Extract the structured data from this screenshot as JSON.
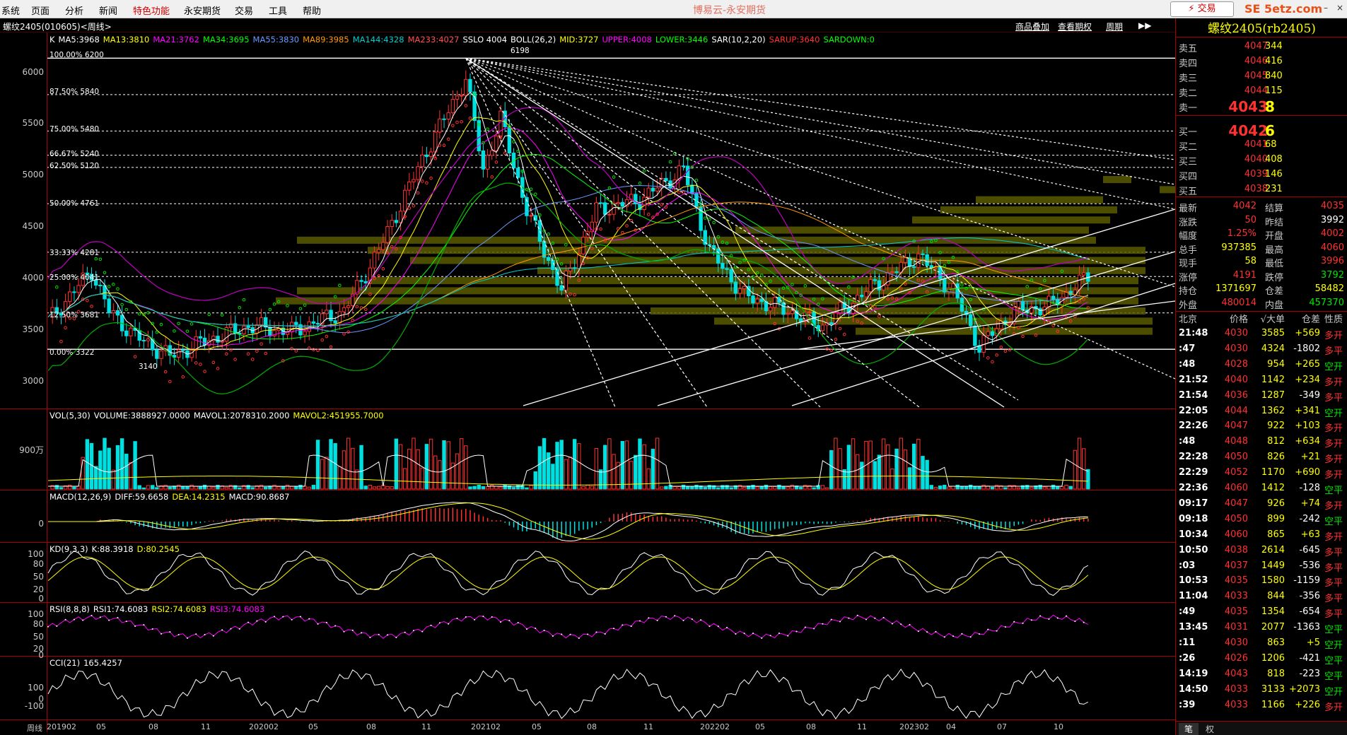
{
  "menu": {
    "items": [
      "系统",
      "页面",
      "分析",
      "新闻",
      "特色功能",
      "永安期货",
      "交易",
      "工具",
      "帮助"
    ],
    "app_title": "博易云-永安期货",
    "trade_button": "⚡ 交易",
    "site_mark": "SE 5etz.com"
  },
  "infobar": {
    "symbol": "螺纹2405(010605)<周线>",
    "links": [
      "商品叠加",
      "查看期权",
      "周期"
    ]
  },
  "main_chart": {
    "legend": [
      {
        "text": "K",
        "color": "#ffffff"
      },
      {
        "text": "MA5:3968",
        "color": "#ffffff"
      },
      {
        "text": "MA13:3810",
        "color": "#ffff00"
      },
      {
        "text": "MA21:3762",
        "color": "#ff00ff"
      },
      {
        "text": "MA34:3695",
        "color": "#00ff00"
      },
      {
        "text": "MA55:3830",
        "color": "#6699ff"
      },
      {
        "text": "MA89:3985",
        "color": "#ff9900"
      },
      {
        "text": "MA144:4328",
        "color": "#00cccc"
      },
      {
        "text": "MA233:4027",
        "color": "#ff5050"
      },
      {
        "text": "SSLO 4004",
        "color": "#ffffff"
      },
      {
        "text": "BOLL(26,2)",
        "color": "#ffffff"
      },
      {
        "text": "MID:3727",
        "color": "#ffff00"
      },
      {
        "text": "UPPER:4008",
        "color": "#ff00ff"
      },
      {
        "text": "LOWER:3446",
        "color": "#00ff00"
      },
      {
        "text": "SAR(10,2,20)",
        "color": "#ffffff"
      },
      {
        "text": "SARUP:3640",
        "color": "#ff3232"
      },
      {
        "text": "SARDOWN:0",
        "color": "#00ff00"
      }
    ],
    "y_labels": [
      "6000",
      "5500",
      "5000",
      "4500",
      "4000",
      "3500",
      "3000"
    ],
    "fib_labels": [
      "100.00% 6200",
      "87.50% 5840",
      "75.00% 5480",
      "66.67% 5240",
      "62.50% 5120",
      "50.00% 4761",
      "33.33% 4281",
      "25.00% 4041",
      "12.50% 3681",
      "0.00% 3322"
    ],
    "high_label": "6198",
    "low_label": "3140"
  },
  "vol_panel": {
    "legend": [
      {
        "text": "VOL(5,30)",
        "color": "#ffffff"
      },
      {
        "text": "VOLUME:3888927.0000",
        "color": "#ffffff"
      },
      {
        "text": "MAVOL1:2078310.2000",
        "color": "#ffffff"
      },
      {
        "text": "MAVOL2:451955.7000",
        "color": "#ffff00"
      }
    ],
    "y_labels": [
      "900万"
    ]
  },
  "macd_panel": {
    "legend": [
      {
        "text": "MACD(12,26,9)",
        "color": "#ffffff"
      },
      {
        "text": "DIFF:59.6658",
        "color": "#ffffff"
      },
      {
        "text": "DEA:14.2315",
        "color": "#ffff00"
      },
      {
        "text": "MACD:90.8687",
        "color": "#ffffff"
      }
    ],
    "y_labels": [
      "0"
    ]
  },
  "kd_panel": {
    "legend": [
      {
        "text": "KD(9,3,3)",
        "color": "#ffffff"
      },
      {
        "text": "K:88.3918",
        "color": "#ffffff"
      },
      {
        "text": "D:80.2545",
        "color": "#ffff00"
      }
    ],
    "y_labels": [
      "100",
      "80",
      "50",
      "20",
      "0"
    ]
  },
  "rsi_panel": {
    "legend": [
      {
        "text": "RSI(8,8,8)",
        "color": "#ffffff"
      },
      {
        "text": "RSI1:74.6083",
        "color": "#ffffff"
      },
      {
        "text": "RSI2:74.6083",
        "color": "#ffff00"
      },
      {
        "text": "RSI3:74.6083",
        "color": "#ff00ff"
      }
    ],
    "y_labels": [
      "100",
      "80",
      "50",
      "20",
      "0"
    ]
  },
  "cci_panel": {
    "legend": [
      {
        "text": "CCI(21)",
        "color": "#ffffff"
      },
      {
        "text": "165.4257",
        "color": "#ffffff"
      }
    ],
    "y_labels": [
      "100",
      "0",
      "-100"
    ]
  },
  "x_axis": {
    "title": "周线",
    "labels": [
      "201902",
      "05",
      "08",
      "11",
      "202002",
      "05",
      "08",
      "11",
      "202102",
      "05",
      "08",
      "11",
      "202202",
      "05",
      "08",
      "11",
      "202302",
      "04",
      "07",
      "10"
    ]
  },
  "quote": {
    "title": "螺纹2405(rb2405)",
    "asks": [
      {
        "label": "卖五",
        "price": "4047",
        "vol": "344"
      },
      {
        "label": "卖四",
        "price": "4046",
        "vol": "416"
      },
      {
        "label": "卖三",
        "price": "4045",
        "vol": "840"
      },
      {
        "label": "卖二",
        "price": "4044",
        "vol": "115"
      },
      {
        "label": "卖一",
        "price": "4043",
        "vol": "8"
      }
    ],
    "bids": [
      {
        "label": "买一",
        "price": "4042",
        "vol": "6"
      },
      {
        "label": "买二",
        "price": "4041",
        "vol": "68"
      },
      {
        "label": "买三",
        "price": "4040",
        "vol": "408"
      },
      {
        "label": "买四",
        "price": "4039",
        "vol": "146"
      },
      {
        "label": "买五",
        "price": "4038",
        "vol": "231"
      }
    ],
    "stats": [
      {
        "l1": "最新",
        "v1": "4042",
        "c1": "red",
        "l2": "结算",
        "v2": "4035",
        "c2": "red"
      },
      {
        "l1": "涨跌",
        "v1": "50",
        "c1": "red",
        "l2": "昨结",
        "v2": "3992",
        "c2": "white"
      },
      {
        "l1": "幅度",
        "v1": "1.25%",
        "c1": "red",
        "l2": "开盘",
        "v2": "4002",
        "c2": "red"
      },
      {
        "l1": "总手",
        "v1": "937385",
        "c1": "yellow",
        "l2": "最高",
        "v2": "4060",
        "c2": "red"
      },
      {
        "l1": "现手",
        "v1": "58",
        "c1": "yellow",
        "l2": "最低",
        "v2": "3996",
        "c2": "red"
      },
      {
        "l1": "涨停",
        "v1": "4191",
        "c1": "red",
        "l2": "跌停",
        "v2": "3792",
        "c2": "green"
      },
      {
        "l1": "持仓",
        "v1": "1371697",
        "c1": "yellow",
        "l2": "仓差",
        "v2": "58482",
        "c2": "yellow"
      },
      {
        "l1": "外盘",
        "v1": "480014",
        "c1": "red",
        "l2": "内盘",
        "v2": "457370",
        "c2": "green"
      }
    ],
    "tick_header": {
      "time": "北京",
      "price": "价格",
      "vol": "√大单",
      "oi": "仓差",
      "type": "性质"
    },
    "ticks": [
      {
        "time": "21:48",
        "price": "4030",
        "vol": "3585",
        "oi": "+569",
        "type": "多开",
        "pc": "red",
        "oc": "yellow",
        "tc": "red"
      },
      {
        "time": ":47",
        "price": "4030",
        "vol": "4324",
        "oi": "-1802",
        "type": "多平",
        "pc": "red",
        "oc": "yellow",
        "tc": "red"
      },
      {
        "time": ":48",
        "price": "4028",
        "vol": "954",
        "oi": "+265",
        "type": "空开",
        "pc": "red",
        "oc": "yellow",
        "tc": "green"
      },
      {
        "time": "21:52",
        "price": "4040",
        "vol": "1142",
        "oi": "+234",
        "type": "多开",
        "pc": "red",
        "oc": "yellow",
        "tc": "red"
      },
      {
        "time": "21:54",
        "price": "4036",
        "vol": "1287",
        "oi": "-349",
        "type": "多平",
        "pc": "red",
        "oc": "yellow",
        "tc": "red"
      },
      {
        "time": "22:05",
        "price": "4044",
        "vol": "1362",
        "oi": "+341",
        "type": "空开",
        "pc": "red",
        "oc": "yellow",
        "tc": "green"
      },
      {
        "time": "22:26",
        "price": "4047",
        "vol": "922",
        "oi": "+103",
        "type": "多开",
        "pc": "red",
        "oc": "yellow",
        "tc": "red"
      },
      {
        "time": ":48",
        "price": "4048",
        "vol": "812",
        "oi": "+634",
        "type": "多开",
        "pc": "red",
        "oc": "yellow",
        "tc": "red"
      },
      {
        "time": "22:28",
        "price": "4050",
        "vol": "826",
        "oi": "+21",
        "type": "多开",
        "pc": "red",
        "oc": "yellow",
        "tc": "red"
      },
      {
        "time": "22:29",
        "price": "4052",
        "vol": "1170",
        "oi": "+690",
        "type": "多开",
        "pc": "red",
        "oc": "yellow",
        "tc": "red"
      },
      {
        "time": "22:36",
        "price": "4060",
        "vol": "1412",
        "oi": "-128",
        "type": "空平",
        "pc": "red",
        "oc": "yellow",
        "tc": "green"
      },
      {
        "time": "09:17",
        "price": "4047",
        "vol": "926",
        "oi": "+74",
        "type": "多开",
        "pc": "red",
        "oc": "yellow",
        "tc": "red"
      },
      {
        "time": "09:18",
        "price": "4050",
        "vol": "899",
        "oi": "-242",
        "type": "空平",
        "pc": "red",
        "oc": "yellow",
        "tc": "green"
      },
      {
        "time": "10:34",
        "price": "4060",
        "vol": "865",
        "oi": "+63",
        "type": "多开",
        "pc": "red",
        "oc": "yellow",
        "tc": "red"
      },
      {
        "time": "10:50",
        "price": "4038",
        "vol": "2614",
        "oi": "-645",
        "type": "多平",
        "pc": "red",
        "oc": "yellow",
        "tc": "red"
      },
      {
        "time": ":03",
        "price": "4037",
        "vol": "1449",
        "oi": "-536",
        "type": "多平",
        "pc": "red",
        "oc": "yellow",
        "tc": "red"
      },
      {
        "time": "10:53",
        "price": "4035",
        "vol": "1580",
        "oi": "-1159",
        "type": "多平",
        "pc": "red",
        "oc": "yellow",
        "tc": "red"
      },
      {
        "time": "11:04",
        "price": "4033",
        "vol": "844",
        "oi": "-356",
        "type": "多平",
        "pc": "red",
        "oc": "yellow",
        "tc": "red"
      },
      {
        "time": ":49",
        "price": "4035",
        "vol": "1354",
        "oi": "-654",
        "type": "多平",
        "pc": "red",
        "oc": "yellow",
        "tc": "red"
      },
      {
        "time": "13:45",
        "price": "4031",
        "vol": "2077",
        "oi": "-1363",
        "type": "空平",
        "pc": "red",
        "oc": "yellow",
        "tc": "green"
      },
      {
        "time": ":11",
        "price": "4030",
        "vol": "863",
        "oi": "+5",
        "type": "空开",
        "pc": "red",
        "oc": "yellow",
        "tc": "green"
      },
      {
        "time": ":26",
        "price": "4026",
        "vol": "1206",
        "oi": "-421",
        "type": "空平",
        "pc": "red",
        "oc": "yellow",
        "tc": "green"
      },
      {
        "time": "14:19",
        "price": "4043",
        "vol": "818",
        "oi": "-223",
        "type": "空平",
        "pc": "red",
        "oc": "yellow",
        "tc": "green"
      },
      {
        "time": "14:50",
        "price": "4033",
        "vol": "3133",
        "oi": "+2073",
        "type": "空开",
        "pc": "red",
        "oc": "yellow",
        "tc": "green"
      },
      {
        "time": ":39",
        "price": "4033",
        "vol": "1166",
        "oi": "+226",
        "type": "多开",
        "pc": "red",
        "oc": "yellow",
        "tc": "red"
      }
    ],
    "bottom_tabs": [
      "笔",
      "权"
    ]
  }
}
